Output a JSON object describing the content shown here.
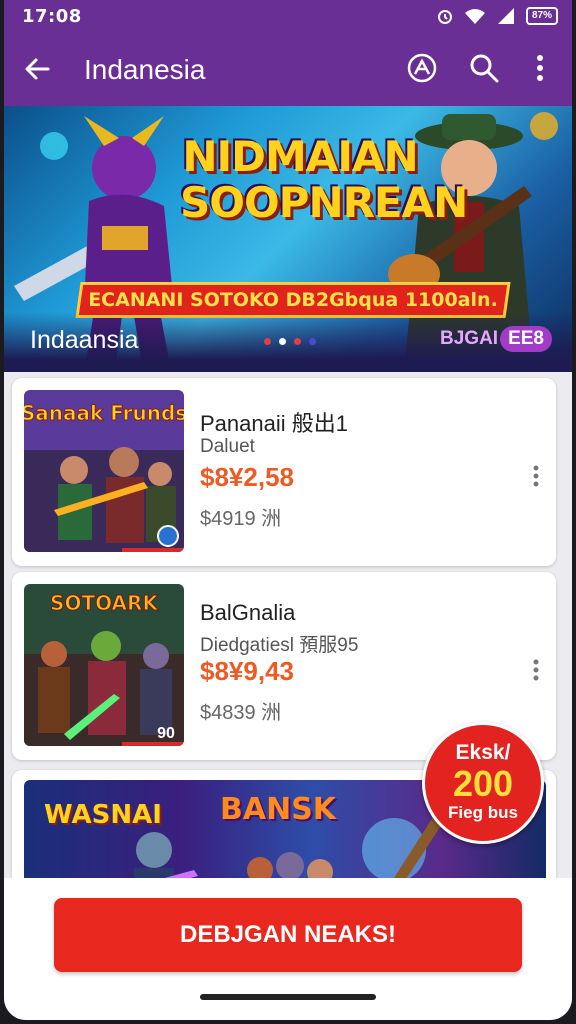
{
  "status": {
    "time": "17:08",
    "battery": "87%"
  },
  "appbar": {
    "title": "Indanesia",
    "back_icon": "arrow-back-icon",
    "actions": [
      "share-icon",
      "search-icon",
      "more-vertical-icon"
    ]
  },
  "banner": {
    "game_title_line1": "NIDMAIAN",
    "game_title_line2": "SOOPNREAN",
    "ribbon_text": "ECANANI SOTOKO DB2Gbqua 1100aln.",
    "title": "Indaansia",
    "badge_label": "BJGAI",
    "badge_count": "EE8",
    "dots_total": 4,
    "dots_active": 2
  },
  "products": [
    {
      "name": "Pananaii 般出1",
      "subtitle": "Daluet",
      "price": "$8¥2,58",
      "old_price": "$4919 洲",
      "thumb_title": "Sanaak Frunds"
    },
    {
      "name": "BalGnalia",
      "subtitle": "Diedgatiesl 預服95",
      "price": "$8¥9,43",
      "old_price": "$4839 洲",
      "thumb_title": "SOTOARK",
      "thumb_tag": "90"
    }
  ],
  "promo": {
    "left_title": "WASNAI",
    "center_title": "BANSK"
  },
  "sticker": {
    "line1": "Eksk/",
    "line2": "200",
    "line3": "Fieg bus"
  },
  "cta": {
    "label": "DEBJGAN NEAKS!"
  },
  "colors": {
    "brand": "#6a2f95",
    "accent": "#e8281e",
    "price": "#ef5a23"
  }
}
